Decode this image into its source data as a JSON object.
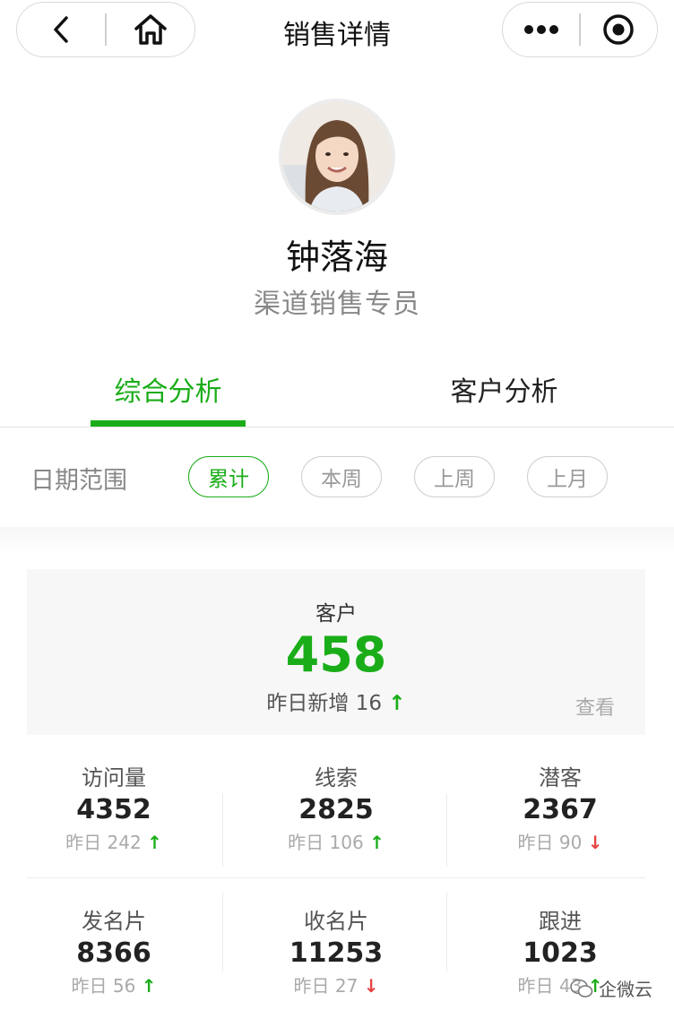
{
  "nav": {
    "title": "销售详情"
  },
  "profile": {
    "name": "钟落海",
    "role": "渠道销售专员"
  },
  "tabs": [
    {
      "label": "综合分析"
    },
    {
      "label": "客户分析"
    }
  ],
  "date_range": {
    "label": "日期范围",
    "options": [
      "累计",
      "本周",
      "上周",
      "上月"
    ],
    "selected": "累计"
  },
  "customer": {
    "label": "客户",
    "value": "458",
    "yesterday": "昨日新增 16",
    "trend_arrow": "↑",
    "view_link": "查看"
  },
  "stats": [
    {
      "label": "访问量",
      "value": "4352",
      "sub": "昨日 242",
      "arrow": "↑",
      "trend": "up"
    },
    {
      "label": "线索",
      "value": "2825",
      "sub": "昨日 106",
      "arrow": "↑",
      "trend": "up"
    },
    {
      "label": "潜客",
      "value": "2367",
      "sub": "昨日 90",
      "arrow": "↓",
      "trend": "down"
    },
    {
      "label": "发名片",
      "value": "8366",
      "sub": "昨日 56",
      "arrow": "↑",
      "trend": "up"
    },
    {
      "label": "收名片",
      "value": "11253",
      "sub": "昨日 27",
      "arrow": "↓",
      "trend": "down"
    },
    {
      "label": "跟进",
      "value": "1023",
      "sub": "昨日 43",
      "arrow": "↑",
      "trend": "up"
    }
  ],
  "watermark": "企微云",
  "colors": {
    "accent": "#1aad19",
    "down": "#e64340"
  }
}
